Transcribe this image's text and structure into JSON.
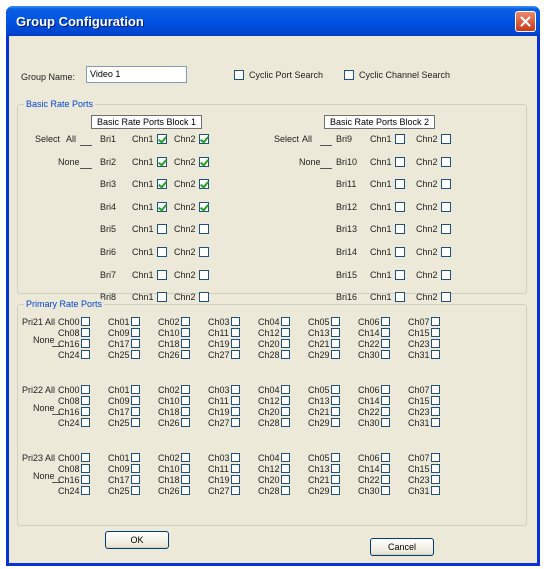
{
  "window": {
    "title": "Group Configuration"
  },
  "group_name": {
    "label": "Group Name:",
    "value": "Video 1"
  },
  "options": {
    "cyclic_port_search": {
      "label": "Cyclic Port Search",
      "checked": false
    },
    "cyclic_channel_search": {
      "label": "Cyclic Channel Search",
      "checked": false
    }
  },
  "basic_rate": {
    "title": "Basic Rate Ports",
    "block1": {
      "title": "Basic Rate Ports Block 1",
      "select_label": "Select",
      "all_label": "All",
      "none_label": "None",
      "rows": [
        {
          "port": "Bri1",
          "ch1": "Chn1",
          "ch1_checked": true,
          "ch2": "Chn2",
          "ch2_checked": true
        },
        {
          "port": "Bri2",
          "ch1": "Chn1",
          "ch1_checked": true,
          "ch2": "Chn2",
          "ch2_checked": true
        },
        {
          "port": "Bri3",
          "ch1": "Chn1",
          "ch1_checked": true,
          "ch2": "Chn2",
          "ch2_checked": true
        },
        {
          "port": "Bri4",
          "ch1": "Chn1",
          "ch1_checked": true,
          "ch2": "Chn2",
          "ch2_checked": true
        },
        {
          "port": "Bri5",
          "ch1": "Chn1",
          "ch1_checked": false,
          "ch2": "Chn2",
          "ch2_checked": false
        },
        {
          "port": "Bri6",
          "ch1": "Chn1",
          "ch1_checked": false,
          "ch2": "Chn2",
          "ch2_checked": false
        },
        {
          "port": "Bri7",
          "ch1": "Chn1",
          "ch1_checked": false,
          "ch2": "Chn2",
          "ch2_checked": false
        },
        {
          "port": "Bri8",
          "ch1": "Chn1",
          "ch1_checked": false,
          "ch2": "Chn2",
          "ch2_checked": false
        }
      ]
    },
    "block2": {
      "title": "Basic Rate Ports Block 2",
      "select_label": "Select",
      "all_label": "All",
      "none_label": "None",
      "rows": [
        {
          "port": "Bri9",
          "ch1": "Chn1",
          "ch1_checked": false,
          "ch2": "Chn2",
          "ch2_checked": false
        },
        {
          "port": "Bri10",
          "ch1": "Chn1",
          "ch1_checked": false,
          "ch2": "Chn2",
          "ch2_checked": false
        },
        {
          "port": "Bri11",
          "ch1": "Chn1",
          "ch1_checked": false,
          "ch2": "Chn2",
          "ch2_checked": false
        },
        {
          "port": "Bri12",
          "ch1": "Chn1",
          "ch1_checked": false,
          "ch2": "Chn2",
          "ch2_checked": false
        },
        {
          "port": "Bri13",
          "ch1": "Chn1",
          "ch1_checked": false,
          "ch2": "Chn2",
          "ch2_checked": false
        },
        {
          "port": "Bri14",
          "ch1": "Chn1",
          "ch1_checked": false,
          "ch2": "Chn2",
          "ch2_checked": false
        },
        {
          "port": "Bri15",
          "ch1": "Chn1",
          "ch1_checked": false,
          "ch2": "Chn2",
          "ch2_checked": false
        },
        {
          "port": "Bri16",
          "ch1": "Chn1",
          "ch1_checked": false,
          "ch2": "Chn2",
          "ch2_checked": false
        }
      ]
    }
  },
  "primary_rate": {
    "title": "Primary Rate Ports",
    "all_label": "All",
    "none_label": "None",
    "channels": [
      "Ch00",
      "Ch01",
      "Ch02",
      "Ch03",
      "Ch04",
      "Ch05",
      "Ch06",
      "Ch07",
      "Ch08",
      "Ch09",
      "Ch10",
      "Ch11",
      "Ch12",
      "Ch13",
      "Ch14",
      "Ch15",
      "Ch16",
      "Ch17",
      "Ch18",
      "Ch19",
      "Ch20",
      "Ch21",
      "Ch22",
      "Ch23",
      "Ch24",
      "Ch25",
      "Ch26",
      "Ch27",
      "Ch28",
      "Ch29",
      "Ch30",
      "Ch31"
    ],
    "ports": [
      {
        "name": "Pri21"
      },
      {
        "name": "Pri22"
      },
      {
        "name": "Pri23"
      }
    ]
  },
  "buttons": {
    "ok": "OK",
    "cancel": "Cancel"
  }
}
